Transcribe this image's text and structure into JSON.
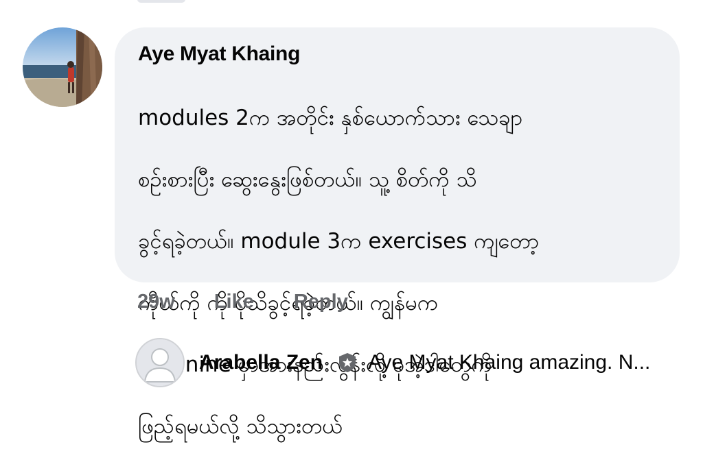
{
  "comment": {
    "author": "Aye Myat Khaing",
    "text_lines": [
      "modules 2က အတိုင်း နှစ်ယောက်သား သေချာ",
      "စဉ်းစားပြီး ဆွေးနွေးဖြစ်တယ်။ သူ့ စိတ်ကို သိ",
      "ခွင့်ရခဲ့တယ်။  module 3က exercises ကျတော့",
      "ကိုယ်ကို ကို ပိုသိခွင့်ရခဲ့တယ်။ ကျွန်မက",
      "feminine  မှာအားနည်းလွန်းလို့ ခုအဲ့ဒါတွေကို",
      "ဖြည့်ရမယ်လို့ သိသွားတယ်"
    ],
    "timestamp": "29w",
    "like_label": "Like",
    "reply_label": "Reply"
  },
  "reply": {
    "author": "Arabella Zen",
    "icon": "shield-badge-icon",
    "preview": "Aye Myat Khaing amazing. N..."
  },
  "colors": {
    "bubble": "#f0f2f5",
    "meta_text": "#65676b",
    "primary_text": "#050505"
  }
}
